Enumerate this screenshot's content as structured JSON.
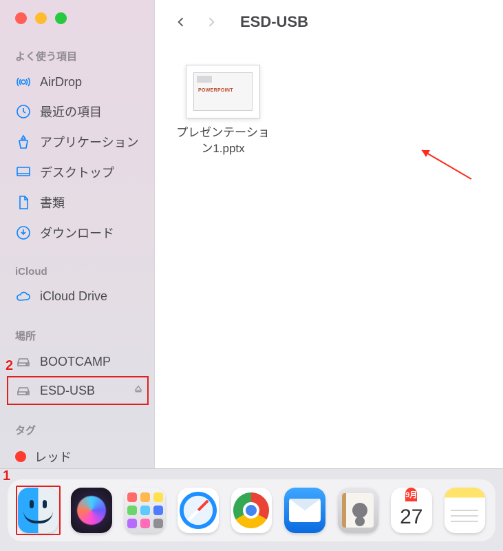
{
  "window": {
    "title": "ESD-USB"
  },
  "sidebar": {
    "sections": {
      "favorites": {
        "title": "よく使う項目",
        "items": [
          {
            "icon": "airdrop-icon",
            "label": "AirDrop"
          },
          {
            "icon": "clock-icon",
            "label": "最近の項目"
          },
          {
            "icon": "apps-icon",
            "label": "アプリケーション"
          },
          {
            "icon": "desktop-icon",
            "label": "デスクトップ"
          },
          {
            "icon": "document-icon",
            "label": "書類"
          },
          {
            "icon": "download-icon",
            "label": "ダウンロード"
          }
        ]
      },
      "icloud": {
        "title": "iCloud",
        "items": [
          {
            "icon": "cloud-icon",
            "label": "iCloud Drive"
          }
        ]
      },
      "locations": {
        "title": "場所",
        "items": [
          {
            "icon": "drive-icon",
            "label": "BOOTCAMP",
            "ejectable": false
          },
          {
            "icon": "drive-icon",
            "label": "ESD-USB",
            "ejectable": true,
            "highlighted": true
          }
        ]
      },
      "tags": {
        "title": "タグ",
        "items": [
          {
            "color": "#ff3b30",
            "label": "レッド"
          }
        ]
      }
    }
  },
  "files": [
    {
      "name": "プレゼンテーション1.pptx",
      "thumb_text": "POWERPOINT"
    }
  ],
  "annotations": {
    "callout1": "1",
    "callout2": "2"
  },
  "dock": {
    "calendar": {
      "month": "9月",
      "day": "27"
    },
    "items": [
      {
        "id": "finder",
        "name": "Finder",
        "selected": true
      },
      {
        "id": "siri",
        "name": "Siri"
      },
      {
        "id": "launchpad",
        "name": "Launchpad"
      },
      {
        "id": "safari",
        "name": "Safari"
      },
      {
        "id": "chrome",
        "name": "Google Chrome"
      },
      {
        "id": "mail",
        "name": "Mail"
      },
      {
        "id": "contacts",
        "name": "Contacts"
      },
      {
        "id": "calendar",
        "name": "Calendar"
      },
      {
        "id": "notes",
        "name": "Notes"
      }
    ]
  }
}
